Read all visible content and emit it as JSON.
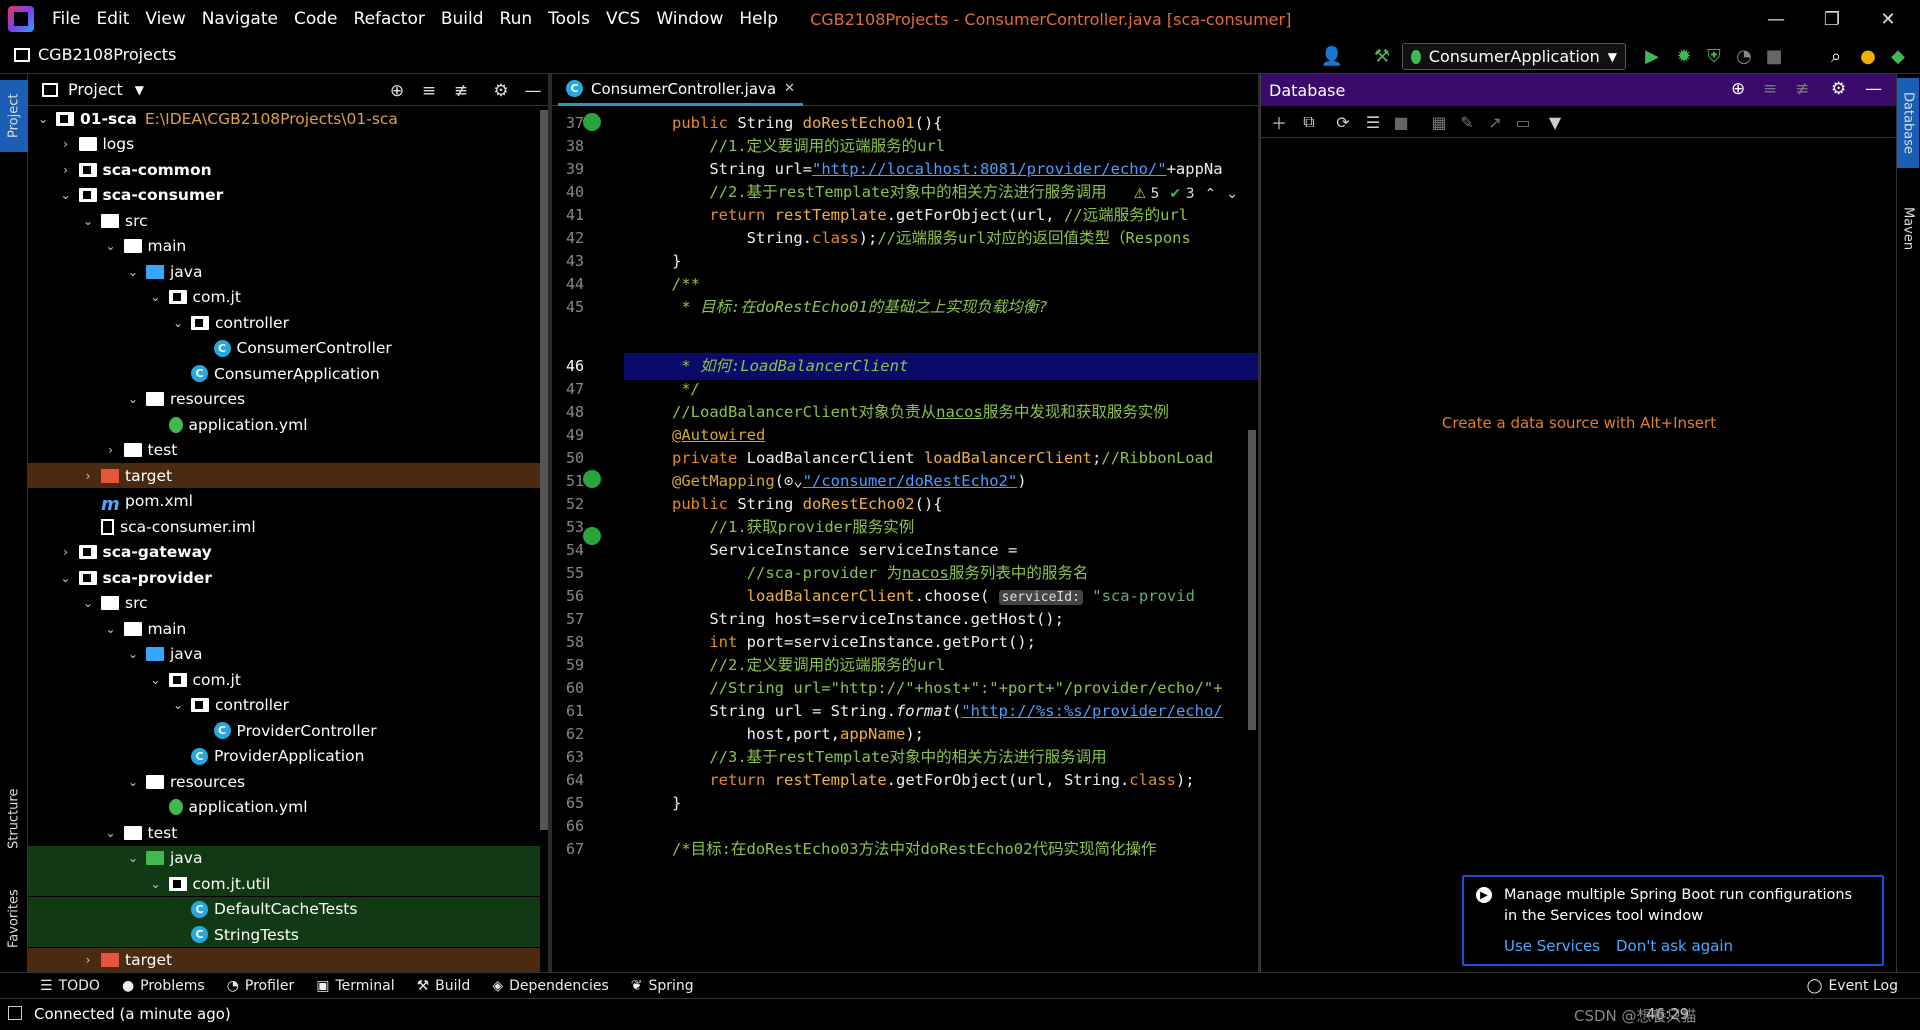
{
  "menu": {
    "items": [
      "File",
      "Edit",
      "View",
      "Navigate",
      "Code",
      "Refactor",
      "Build",
      "Run",
      "Tools",
      "VCS",
      "Window",
      "Help"
    ],
    "title": "CGB2108Projects - ConsumerController.java [sca-consumer]"
  },
  "navbar": {
    "project": "CGB2108Projects",
    "run_config": "ConsumerApplication"
  },
  "left_stripe": {
    "project": "Project",
    "structure": "Structure",
    "favorites": "Favorites"
  },
  "project_panel": {
    "title": "Project",
    "tree": [
      {
        "label": "01-sca",
        "path": "E:\\IDEA\\CGB2108Projects\\01-sca",
        "depth": 0,
        "arrow": "v",
        "icon": "module",
        "bold": true
      },
      {
        "label": "logs",
        "depth": 1,
        "arrow": ">",
        "icon": "folder"
      },
      {
        "label": "sca-common",
        "depth": 1,
        "arrow": ">",
        "icon": "module",
        "bold": true
      },
      {
        "label": "sca-consumer",
        "depth": 1,
        "arrow": "v",
        "icon": "module",
        "bold": true
      },
      {
        "label": "src",
        "depth": 2,
        "arrow": "v",
        "icon": "folder"
      },
      {
        "label": "main",
        "depth": 3,
        "arrow": "v",
        "icon": "folder"
      },
      {
        "label": "java",
        "depth": 4,
        "arrow": "v",
        "icon": "folder-blue"
      },
      {
        "label": "com.jt",
        "depth": 5,
        "arrow": "v",
        "icon": "package"
      },
      {
        "label": "controller",
        "depth": 6,
        "arrow": "v",
        "icon": "package"
      },
      {
        "label": "ConsumerController",
        "depth": 7,
        "arrow": "",
        "icon": "class"
      },
      {
        "label": "ConsumerApplication",
        "depth": 6,
        "arrow": "",
        "icon": "class"
      },
      {
        "label": "resources",
        "depth": 4,
        "arrow": "v",
        "icon": "folder"
      },
      {
        "label": "application.yml",
        "depth": 5,
        "arrow": "",
        "icon": "yml"
      },
      {
        "label": "test",
        "depth": 3,
        "arrow": ">",
        "icon": "folder"
      },
      {
        "label": "target",
        "depth": 2,
        "arrow": ">",
        "icon": "folder-orange",
        "highlight": "target"
      },
      {
        "label": "pom.xml",
        "depth": 2,
        "arrow": "",
        "icon": "maven"
      },
      {
        "label": "sca-consumer.iml",
        "depth": 2,
        "arrow": "",
        "icon": "iml"
      },
      {
        "label": "sca-gateway",
        "depth": 1,
        "arrow": ">",
        "icon": "module",
        "bold": true
      },
      {
        "label": "sca-provider",
        "depth": 1,
        "arrow": "v",
        "icon": "module",
        "bold": true
      },
      {
        "label": "src",
        "depth": 2,
        "arrow": "v",
        "icon": "folder"
      },
      {
        "label": "main",
        "depth": 3,
        "arrow": "v",
        "icon": "folder"
      },
      {
        "label": "java",
        "depth": 4,
        "arrow": "v",
        "icon": "folder-blue"
      },
      {
        "label": "com.jt",
        "depth": 5,
        "arrow": "v",
        "icon": "package"
      },
      {
        "label": "controller",
        "depth": 6,
        "arrow": "v",
        "icon": "package"
      },
      {
        "label": "ProviderController",
        "depth": 7,
        "arrow": "",
        "icon": "class"
      },
      {
        "label": "ProviderApplication",
        "depth": 6,
        "arrow": "",
        "icon": "class"
      },
      {
        "label": "resources",
        "depth": 4,
        "arrow": "v",
        "icon": "folder"
      },
      {
        "label": "application.yml",
        "depth": 5,
        "arrow": "",
        "icon": "yml"
      },
      {
        "label": "test",
        "depth": 3,
        "arrow": "v",
        "icon": "folder"
      },
      {
        "label": "java",
        "depth": 4,
        "arrow": "v",
        "icon": "folder-green",
        "highlight": "test"
      },
      {
        "label": "com.jt.util",
        "depth": 5,
        "arrow": "v",
        "icon": "package",
        "highlight": "test"
      },
      {
        "label": "DefaultCacheTests",
        "depth": 6,
        "arrow": "",
        "icon": "class",
        "highlight": "test"
      },
      {
        "label": "StringTests",
        "depth": 6,
        "arrow": "",
        "icon": "class",
        "highlight": "test"
      },
      {
        "label": "target",
        "depth": 2,
        "arrow": ">",
        "icon": "folder-orange",
        "highlight": "target"
      },
      {
        "label": "pom.xml",
        "depth": 2,
        "arrow": "",
        "icon": "maven"
      }
    ]
  },
  "editor": {
    "tab": "ConsumerController.java",
    "warnings": "5",
    "checks": "3",
    "line_numbers": [
      "37",
      "38",
      "39",
      "40",
      "41",
      "42",
      "43",
      "44",
      "45",
      "46",
      "47",
      "48",
      "49",
      "50",
      "51",
      "52",
      "53",
      "54",
      "55",
      "56",
      "57",
      "58",
      "59",
      "60",
      "61",
      "62",
      "63",
      "64",
      "65",
      "66",
      "67"
    ],
    "current_line": "46"
  },
  "database": {
    "title": "Database",
    "empty_text": "Create a data source with Alt+Insert"
  },
  "right_stripe": {
    "database": "Database",
    "maven": "Maven"
  },
  "notification": {
    "text": "Manage multiple Spring Boot run configurations in the Services tool window",
    "action1": "Use Services",
    "action2": "Don't ask again"
  },
  "bottom_tools": [
    "TODO",
    "Problems",
    "Profiler",
    "Terminal",
    "Build",
    "Dependencies",
    "Spring"
  ],
  "event_log": "Event Log",
  "status": {
    "text": "Connected (a minute ago)",
    "position": "46:29",
    "watermark": "CSDN @想養只猫"
  },
  "colors": {
    "accent": "#3592c4",
    "db_header": "#3a0a6a",
    "notif_border": "#1a4fd8",
    "warning_text": "#e07f2a"
  }
}
